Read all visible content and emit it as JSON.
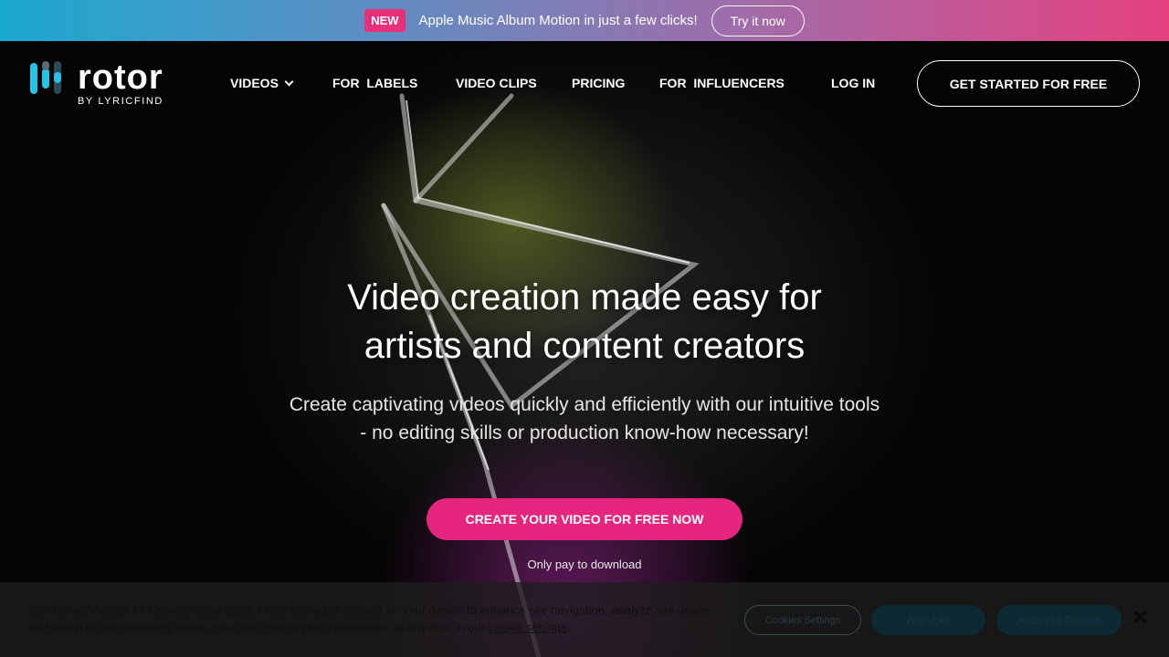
{
  "announcement": {
    "badge": "NEW",
    "text": "Apple Music Album Motion in just a few clicks!",
    "button": "Try it now"
  },
  "logo": {
    "title": "rotor",
    "subtitle": "BY LYRICFIND"
  },
  "nav": {
    "videos": "VIDEOS",
    "for_labels": "FOR  LABELS",
    "video_clips": "VIDEO CLIPS",
    "pricing": "PRICING",
    "for_influencers": "FOR  INFLUENCERS",
    "login": "LOG IN",
    "get_started": "GET STARTED FOR FREE"
  },
  "hero": {
    "title_line1": "Video creation made easy for",
    "title_line2": "artists and content creators",
    "subtitle_line1": "Create captivating videos quickly and efficiently with our intuitive tools",
    "subtitle_line2": "- no editing skills or production know-how necessary!",
    "cta": "CREATE YOUR VIDEO FOR FREE NOW",
    "note": "Only pay to download"
  },
  "cookie": {
    "text_part1": "By clicking “Accept All Cookies”, you agree to the storing of cookies on your device to enhance site navigation, analyze site usage, and assist in our marketing efforts. You can change your preferences at any time in our ",
    "link": "cookie settings",
    "text_part2": ".",
    "settings_button": "Cookies Settings",
    "reject_button": "Reject All",
    "accept_button": "Accept All Cookies"
  },
  "colors": {
    "brand_pink": "#e6267e",
    "brand_cyan": "#1ba9cf",
    "background": "#040404"
  },
  "icons": {
    "nav_dropdown": "chevron-down-icon",
    "cookie_close": "close-icon",
    "logo_mark": "rotor-logo-icon"
  }
}
